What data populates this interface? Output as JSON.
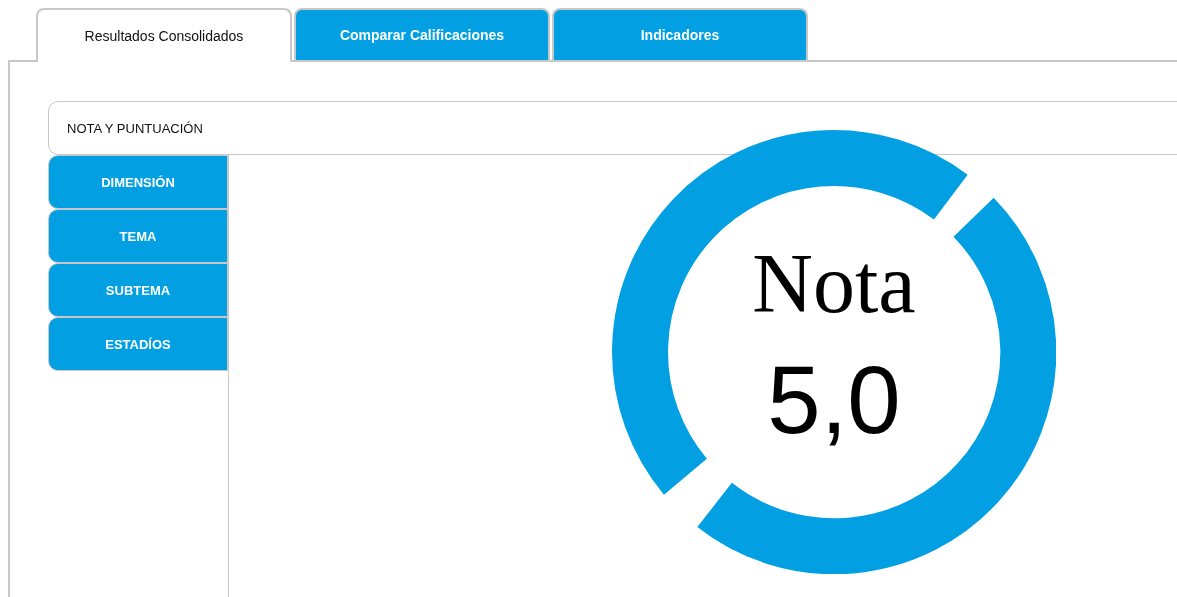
{
  "tabs": [
    {
      "label": "Resultados Consolidados",
      "selected": true
    },
    {
      "label": "Comparar Calificaciones",
      "selected": false
    },
    {
      "label": "Indicadores",
      "selected": false
    }
  ],
  "side_tabs": [
    {
      "label": "NOTA Y PUNTUACIÓN",
      "selected": true
    },
    {
      "label": "DIMENSIÓN",
      "selected": false
    },
    {
      "label": "TEMA",
      "selected": false
    },
    {
      "label": "SUBTEMA",
      "selected": false
    },
    {
      "label": "ESTADÍOS",
      "selected": false
    }
  ],
  "score": {
    "label": "Nota",
    "value": "5,0"
  }
}
